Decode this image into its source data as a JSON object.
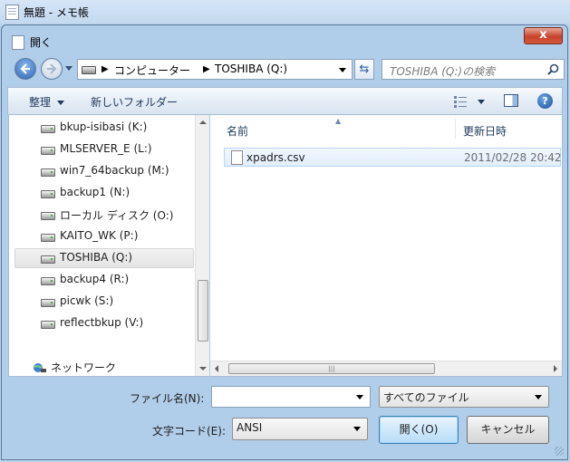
{
  "background_window": {
    "title": "無題 - メモ帳"
  },
  "dialog": {
    "title": "開く",
    "close_label": "x",
    "address": {
      "segment1": "コンピューター",
      "segment2": "TOSHIBA (Q:)"
    },
    "search": {
      "placeholder": "TOSHIBA (Q:)の検索"
    },
    "toolbar": {
      "organize_label": "整理",
      "new_folder_label": "新しいフォルダー"
    },
    "nav_items": [
      {
        "label": "bkup-isibasi (K:)",
        "icon": "drive-icon"
      },
      {
        "label": "MLSERVER_E (L:)",
        "icon": "drive-icon"
      },
      {
        "label": "win7_64backup (M:)",
        "icon": "drive-icon"
      },
      {
        "label": "backup1 (N:)",
        "icon": "drive-icon"
      },
      {
        "label": "ローカル ディスク (O:)",
        "icon": "drive-icon"
      },
      {
        "label": "KAITO_WK (P:)",
        "icon": "drive-icon"
      },
      {
        "label": "TOSHIBA (Q:)",
        "icon": "drive-icon",
        "selected": true
      },
      {
        "label": "backup4 (R:)",
        "icon": "drive-icon"
      },
      {
        "label": "picwk (S:)",
        "icon": "drive-icon"
      },
      {
        "label": "reflectbkup (V:)",
        "icon": "drive-icon"
      }
    ],
    "network_label": "ネットワーク",
    "columns": {
      "name": "名前",
      "date": "更新日時"
    },
    "files": [
      {
        "name": "xpadrs.csv",
        "date": "2011/02/28 20:42"
      }
    ],
    "filename_label": "ファイル名(N):",
    "filename_value": "",
    "filetype_value": "すべてのファイル",
    "encoding_label": "文字コード(E):",
    "encoding_value": "ANSI",
    "open_button": "開く(O)",
    "cancel_button": "キャンセル"
  }
}
